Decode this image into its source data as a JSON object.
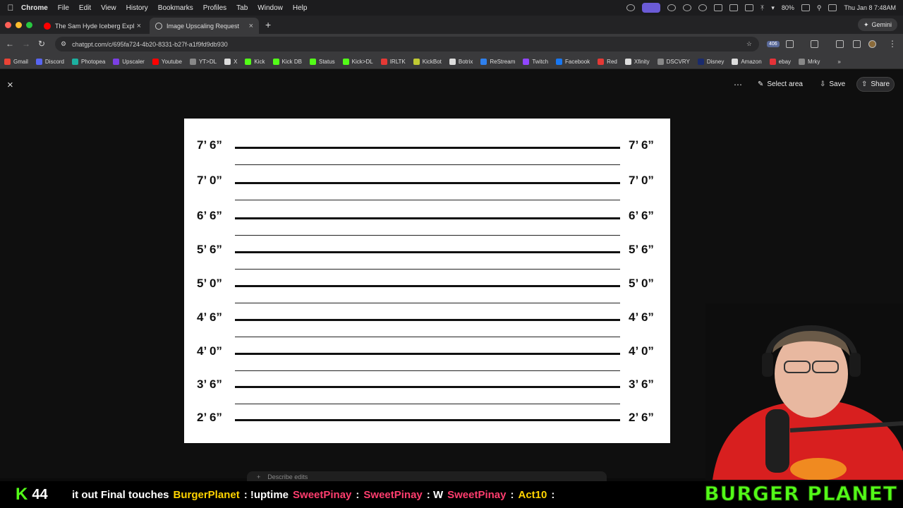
{
  "menubar": {
    "app": "Chrome",
    "items": [
      "File",
      "Edit",
      "View",
      "History",
      "Bookmarks",
      "Profiles",
      "Tab",
      "Window",
      "Help"
    ],
    "battery": "80%",
    "clock": "Thu Jan 8  7:48AM"
  },
  "tabs": [
    {
      "title": "The Sam Hyde Iceberg Expla"
    },
    {
      "title": "Image Upscaling Request"
    }
  ],
  "gemini_label": "Gemini",
  "url": "chatgpt.com/c/695fa724-4b20-8331-b27f-a1f9fd9db930",
  "ext_badge": "406",
  "bookmarks": [
    {
      "label": "Gmail",
      "color": "#ea4335"
    },
    {
      "label": "Discord",
      "color": "#5865f2"
    },
    {
      "label": "Photopea",
      "color": "#1cb0a0"
    },
    {
      "label": "Upscaler",
      "color": "#7b3fe4"
    },
    {
      "label": "Youtube",
      "color": "#ff0000"
    },
    {
      "label": "YT>DL",
      "color": "#888888"
    },
    {
      "label": "X",
      "color": "#dddddd"
    },
    {
      "label": "Kick",
      "color": "#53fc18"
    },
    {
      "label": "Kick DB",
      "color": "#53fc18"
    },
    {
      "label": "Status",
      "color": "#53fc18"
    },
    {
      "label": "Kick>DL",
      "color": "#53fc18"
    },
    {
      "label": "IRLTK",
      "color": "#e53935"
    },
    {
      "label": "KickBot",
      "color": "#c0ca33"
    },
    {
      "label": "Botrix",
      "color": "#dddddd"
    },
    {
      "label": "ReStream",
      "color": "#2f80ed"
    },
    {
      "label": "Twitch",
      "color": "#9146ff"
    },
    {
      "label": "Facebook",
      "color": "#1877f2"
    },
    {
      "label": "Red",
      "color": "#e53935"
    },
    {
      "label": "Xfinity",
      "color": "#dddddd"
    },
    {
      "label": "DSCVRY",
      "color": "#888888"
    },
    {
      "label": "Disney",
      "color": "#1a2b6d"
    },
    {
      "label": "Amazon",
      "color": "#dddddd"
    },
    {
      "label": "ebay",
      "color": "#e53238"
    },
    {
      "label": "Mrky",
      "color": "#888888"
    }
  ],
  "viewer": {
    "select_area": "Select area",
    "save": "Save",
    "share": "Share"
  },
  "height_chart": {
    "marks": [
      "7’ 6”",
      "7’ 0”",
      "6’ 6”",
      "5’ 6”",
      "5’ 0”",
      "4’ 6”",
      "4’ 0”",
      "3’ 6”",
      "2’ 6”"
    ]
  },
  "composer": {
    "placeholder": "Describe edits"
  },
  "stream": {
    "viewer_count": "44",
    "ticker": [
      {
        "text": "it out Final touches",
        "style": "wt"
      },
      {
        "text": "BurgerPlanet",
        "style": "yl"
      },
      {
        "text": ": !uptime",
        "style": "wt"
      },
      {
        "text": "SweetPinay",
        "style": "pk"
      },
      {
        "text": ":",
        "style": "wt"
      },
      {
        "text": "SweetPinay",
        "style": "pk"
      },
      {
        "text": ": W",
        "style": "wt"
      },
      {
        "text": "SweetPinay",
        "style": "pk"
      },
      {
        "text": ":",
        "style": "wt"
      },
      {
        "text": "Act10",
        "style": "yl"
      },
      {
        "text": ":",
        "style": "wt"
      }
    ],
    "brand": "BURGER PLANET"
  }
}
